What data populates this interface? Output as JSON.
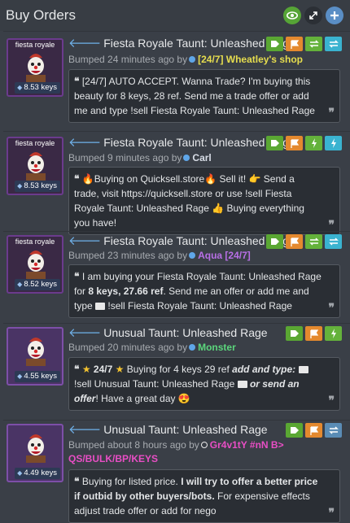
{
  "header": {
    "title": "Buy Orders"
  },
  "orders": [
    {
      "item_name": "fiesta royale",
      "price": "8.53 keys",
      "title": "Fiesta Royale Taunt: Unleashed Rage",
      "bump_prefix": "Bumped 24 minutes ago by",
      "user": "[24/7] Wheatley's shop",
      "note": "[24/7] AUTO ACCEPT. Wanna Trade? I'm buying this beauty for 8 keys, 28 ref. Send me a trade offer or add me and type !sell Fiesta Royale Taunt: Unleashed Rage"
    },
    {
      "item_name": "fiesta royale",
      "price": "8.53 keys",
      "title": "Fiesta Royale Taunt: Unleashed Rage",
      "bump_prefix": "Bumped 9 minutes ago by",
      "user": "Carl",
      "note_a": "Buying on Quicksell.store",
      "note_b": "Sell it!",
      "note_c": "Send a trade, visit https://quicksell.store or use !sell Fiesta Royale Taunt: Unleashed Rage",
      "note_d": "Buying everything you have!"
    },
    {
      "item_name": "fiesta royale",
      "price": "8.52 keys",
      "title": "Fiesta Royale Taunt: Unleashed Rage",
      "bump_prefix": "Bumped 23 minutes ago by",
      "user": "Aqua [24/7]",
      "note_a": "I am buying your Fiesta Royale Taunt: Unleashed Rage for",
      "note_b": "8 keys, 27.66 ref",
      "note_c": ". Send me an offer or add me and type",
      "note_d": "!sell Fiesta Royale Taunt: Unleashed Rage"
    },
    {
      "price": "4.55 keys",
      "title": "Unusual Taunt: Unleashed Rage",
      "bump_prefix": "Bumped 20 minutes ago by",
      "user": "Monster",
      "note_a": "24/7",
      "note_b": "Buying for 4 keys 29 ref",
      "note_c": "add and type:",
      "note_d": "!sell Unusual Taunt: Unleashed Rage",
      "note_e": "or send an offer",
      "note_f": "! Have a great day"
    },
    {
      "price": "4.49 keys",
      "title": "Unusual Taunt: Unleashed Rage",
      "bump_prefix": "Bumped about 8 hours ago by",
      "user": "Gr4v1tY #nN B> QS/BULK/BP/KEYS",
      "note_a": "Buying for listed price.",
      "note_b": "I will try to offer a better price if outbid by other buyers/bots.",
      "note_c": "For expensive effects adjust trade offer or add for nego"
    }
  ],
  "colors": {
    "accent_green": "#5aa733",
    "accent_orange": "#e4892e",
    "accent_teal": "#3ab3d0",
    "item_border": "#6b3b8d"
  }
}
